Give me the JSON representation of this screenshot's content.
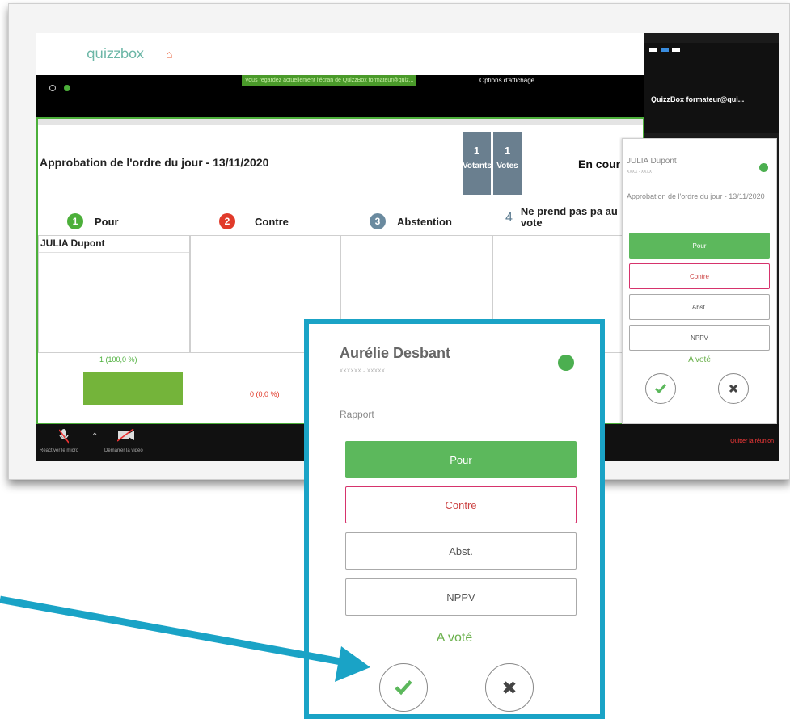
{
  "quizzbox": {
    "logo": "quizzbox",
    "home_icon": "home-icon"
  },
  "zoom": {
    "share_banner": "Vous regardez actuellement l'écran de QuizzBox formateur@quiz...",
    "display_options": "Options d'affichage",
    "participant_name": "QuizzBox formateur@qui...",
    "toolbar": {
      "mic_label": "Réactiver le micro",
      "video_label": "Démarrer la vidéo",
      "quit_label": "Quitter la réunion"
    }
  },
  "vote": {
    "title": "Approbation de l'ordre du jour - 13/11/2020",
    "votants_count": "1",
    "votants_label": "Votants",
    "votes_count": "1",
    "votes_label": "Votes",
    "status": "En cour",
    "options": [
      {
        "num": "1",
        "label": "Pour",
        "color": "#4caf3a"
      },
      {
        "num": "2",
        "label": "Contre",
        "color": "#e13a2a"
      },
      {
        "num": "3",
        "label": "Abstention",
        "color": "#6a8a9f"
      },
      {
        "num": "4",
        "label": "Ne prend pas pa au vote",
        "color": "#5a7a8f"
      }
    ],
    "voter": "JULIA Dupont",
    "results": [
      {
        "label": "1 (100,0 %)",
        "fraction": 1.0
      },
      {
        "label": "0 (0,0 %)",
        "fraction": 0.0
      }
    ]
  },
  "side_panel": {
    "name": "JULIA Dupont",
    "sub": "XXXX - XXXX",
    "rapport": "Approbation de l'ordre du jour - 13/11/2020",
    "buttons": [
      "Pour",
      "Contre",
      "Abst.",
      "NPPV"
    ],
    "voted": "A voté"
  },
  "callout": {
    "name": "Aurélie Desbant",
    "sub": "XXXXXX - XXXXX",
    "rapport": "Rapport",
    "buttons": [
      "Pour",
      "Contre",
      "Abst.",
      "NPPV"
    ],
    "voted": "A voté"
  },
  "colors": {
    "accent_green": "#5cb85c",
    "contre_pink": "#d6336c",
    "callout_border": "#1aa3c6",
    "arrow": "#1aa3c6"
  }
}
